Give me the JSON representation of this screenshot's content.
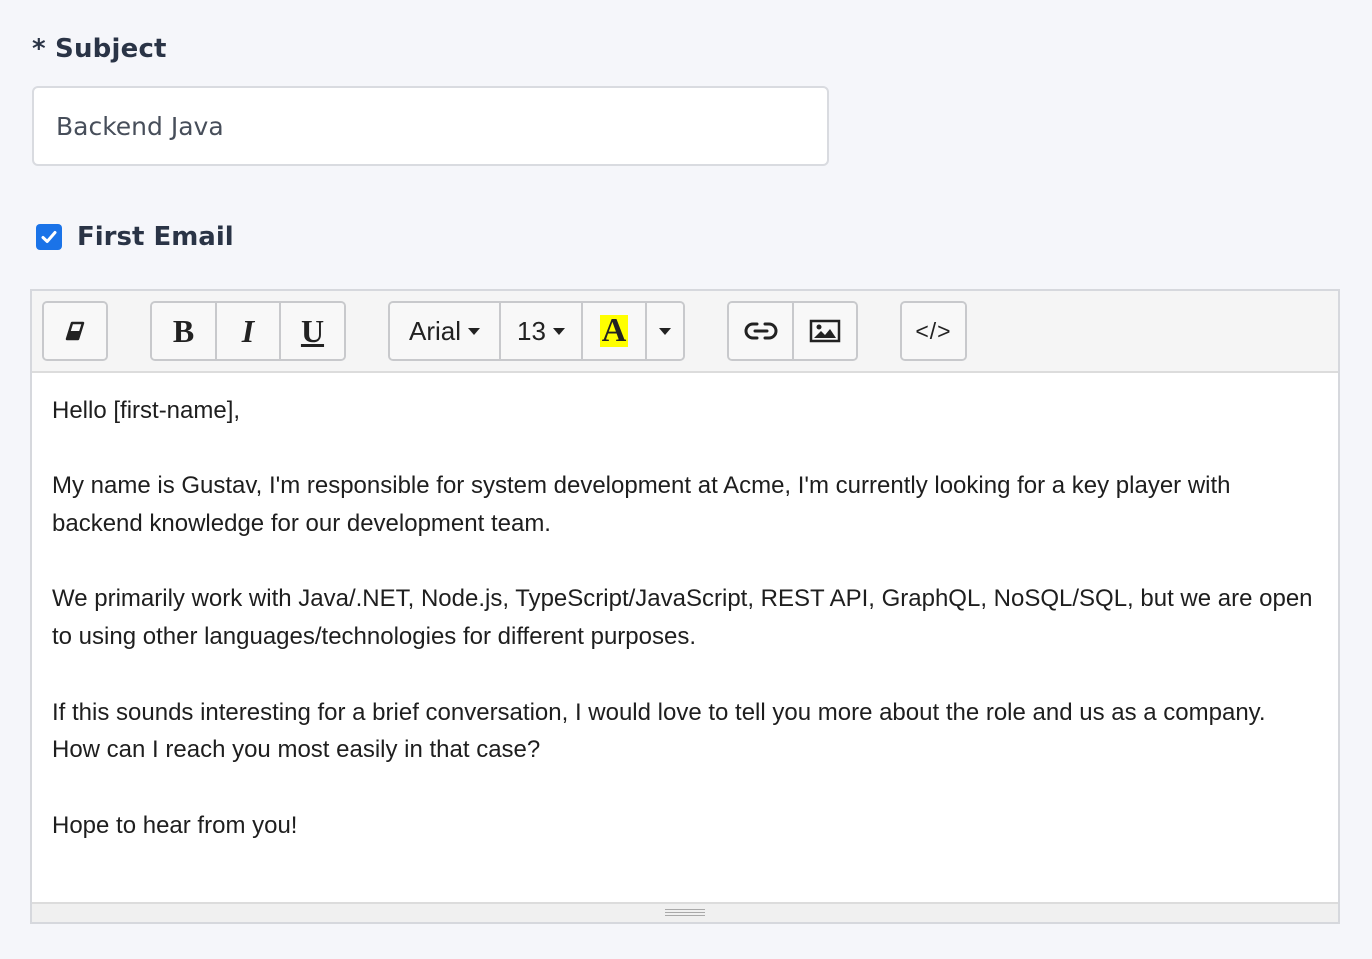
{
  "subject": {
    "label": "* Subject",
    "value": "Backend Java"
  },
  "first_email": {
    "label": "First Email",
    "checked": true
  },
  "toolbar": {
    "font_family": "Arial",
    "font_size": "13",
    "text_color_label": "A",
    "highlight_color": "#ffff00",
    "code_view_label": "</>",
    "icons": [
      "eraser-icon",
      "bold-icon",
      "italic-icon",
      "underline-icon",
      "link-icon",
      "image-icon",
      "code-view-icon"
    ]
  },
  "body": {
    "paragraphs": [
      "Hello [first-name],",
      "My name is Gustav, I'm responsible for system development at Acme, I'm currently looking for a key player with backend knowledge for our development team.",
      "We primarily work with Java/.NET, Node.js, TypeScript/JavaScript, REST API, GraphQL, NoSQL/SQL, but we are open to using other languages/technologies for different purposes.",
      "If this sounds interesting for a brief conversation, I would love to tell you more about the role and us as a company. How can I reach you most easily in that case?",
      "Hope to hear from you!"
    ]
  },
  "colors": {
    "accent": "#1a73e8",
    "page_background": "#f5f6fa"
  }
}
